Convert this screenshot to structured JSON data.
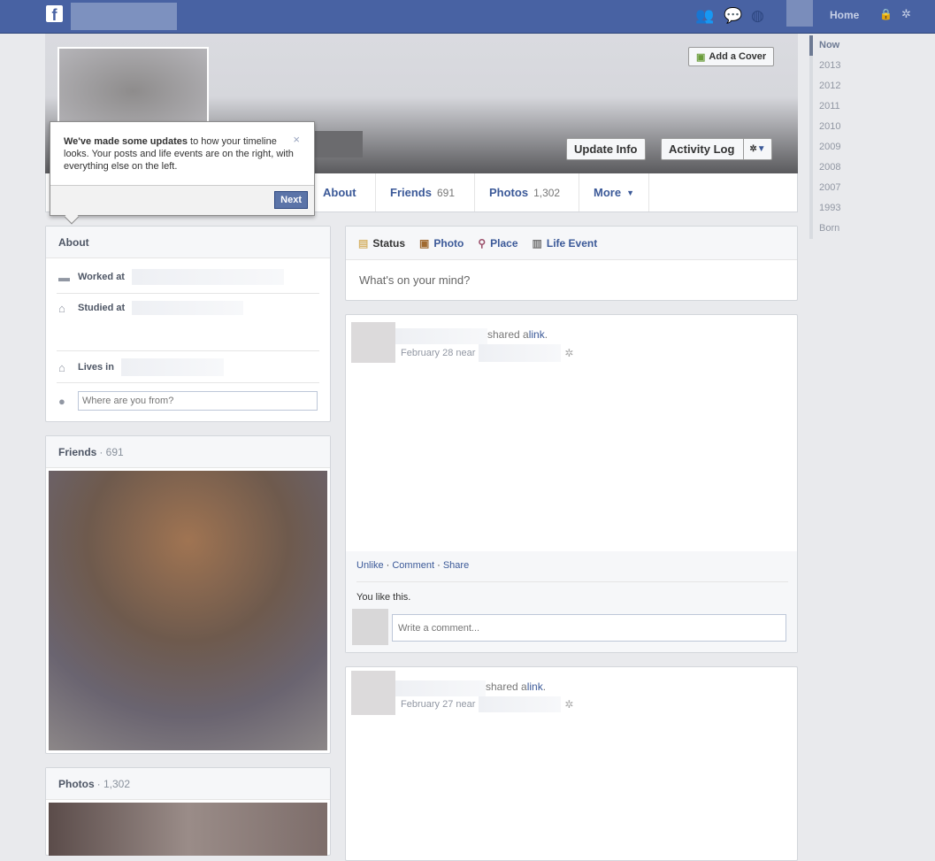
{
  "topbar": {
    "home": "Home",
    "icons": [
      "friend-requests-icon",
      "messages-icon",
      "notifications-globe-icon",
      "privacy-lock-icon",
      "settings-gear-icon"
    ]
  },
  "cover": {
    "add_cover": "Add a Cover",
    "update_info": "Update Info",
    "activity_log": "Activity Log"
  },
  "nav": {
    "about": "About",
    "friends": "Friends",
    "friends_count": "691",
    "photos": "Photos",
    "photos_count": "1,302",
    "more": "More"
  },
  "tooltip": {
    "bold": "We've made some updates",
    "text": " to how your timeline looks. Your posts and life events are on the right, with everything else on the left.",
    "next": "Next",
    "close": "×"
  },
  "about": {
    "title": "About",
    "worked": "Worked at",
    "studied": "Studied at",
    "lives": "Lives in",
    "from_placeholder": "Where are you from?"
  },
  "friends_box": {
    "title": "Friends",
    "count": "· 691"
  },
  "photos_box": {
    "title": "Photos",
    "count": "· 1,302"
  },
  "composer": {
    "status": "Status",
    "photo": "Photo",
    "place": "Place",
    "life_event": "Life Event",
    "placeholder": "What's on your mind?"
  },
  "posts": [
    {
      "action": "shared a ",
      "link": "link",
      "dot": ".",
      "date": "February 28 near",
      "unlike": "Unlike",
      "comment": "Comment",
      "share": "Share",
      "likes": "You like this.",
      "comment_placeholder": "Write a comment..."
    },
    {
      "action": "shared a ",
      "link": "link",
      "dot": ".",
      "date": "February 27 near"
    }
  ],
  "scrubber": [
    "Now",
    "2013",
    "2012",
    "2011",
    "2010",
    "2009",
    "2008",
    "2007",
    "1993",
    "Born"
  ]
}
